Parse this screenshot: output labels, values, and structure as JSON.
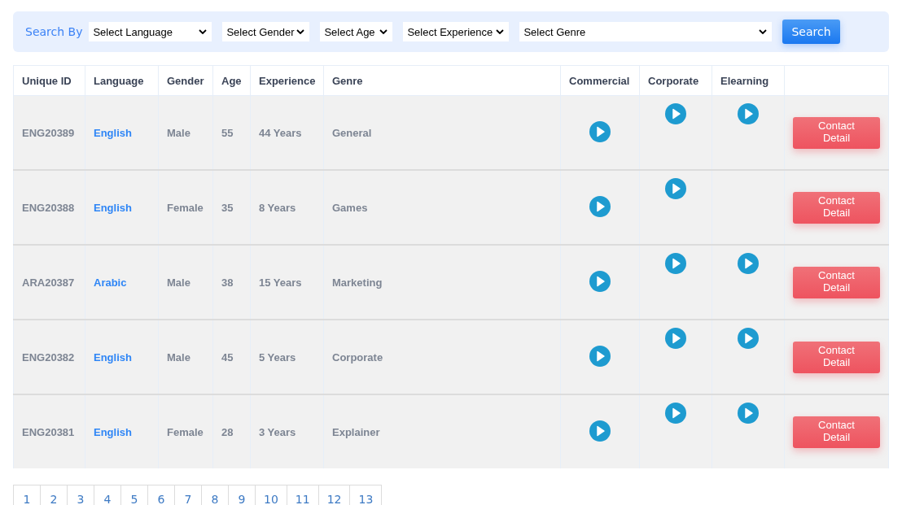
{
  "search_bar": {
    "label": "Search By",
    "filters": [
      {
        "placeholder": "Select Language"
      },
      {
        "placeholder": "Select Gender"
      },
      {
        "placeholder": "Select Age"
      },
      {
        "placeholder": "Select Experience"
      },
      {
        "placeholder": "Select Genre"
      }
    ],
    "button": "Search"
  },
  "table": {
    "columns": [
      "Unique ID",
      "Language",
      "Gender",
      "Age",
      "Experience",
      "Genre",
      "Commercial",
      "Corporate",
      "Elearning"
    ],
    "rows": [
      {
        "id": "ENG20389",
        "language": "English",
        "gender": "Male",
        "age": "55",
        "experience": "44 Years",
        "genre": "General",
        "commercial": true,
        "corporate": true,
        "elearning": true,
        "action": "Contact Detail"
      },
      {
        "id": "ENG20388",
        "language": "English",
        "gender": "Female",
        "age": "35",
        "experience": "8 Years",
        "genre": "Games",
        "commercial": true,
        "corporate": true,
        "elearning": false,
        "action": "Contact Detail"
      },
      {
        "id": "ARA20387",
        "language": "Arabic",
        "gender": "Male",
        "age": "38",
        "experience": "15 Years",
        "genre": "Marketing",
        "commercial": true,
        "corporate": true,
        "elearning": true,
        "action": "Contact Detail"
      },
      {
        "id": "ENG20382",
        "language": "English",
        "gender": "Male",
        "age": "45",
        "experience": "5 Years",
        "genre": "Corporate",
        "commercial": true,
        "corporate": true,
        "elearning": true,
        "action": "Contact Detail"
      },
      {
        "id": "ENG20381",
        "language": "English",
        "gender": "Female",
        "age": "28",
        "experience": "3 Years",
        "genre": "Explainer",
        "commercial": true,
        "corporate": true,
        "elearning": true,
        "action": "Contact Detail"
      }
    ]
  },
  "pagination": [
    "1",
    "2",
    "3",
    "4",
    "5",
    "6",
    "7",
    "8",
    "9",
    "10",
    "11",
    "12",
    "13"
  ]
}
